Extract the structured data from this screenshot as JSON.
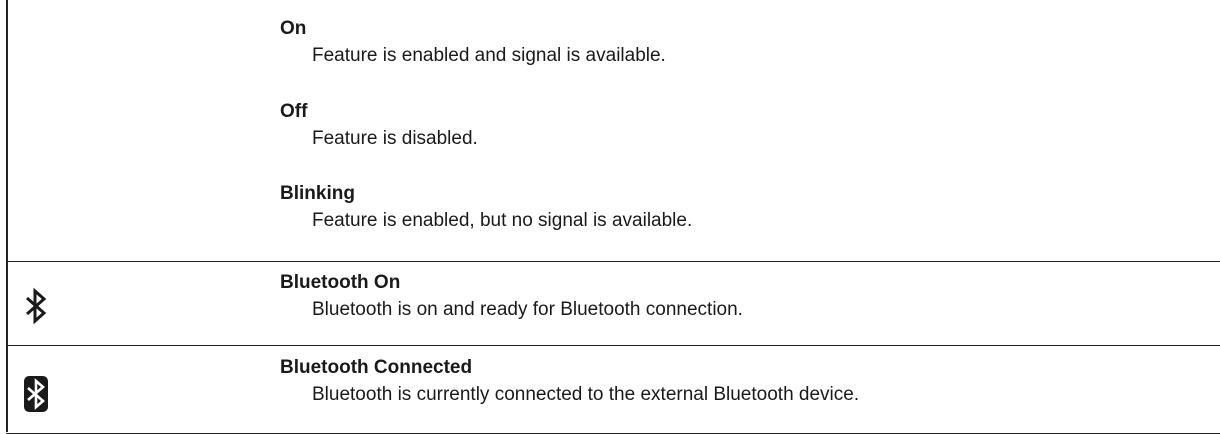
{
  "rows": [
    {
      "entries": [
        {
          "term": "On",
          "description": "Feature is enabled and signal is available."
        },
        {
          "term": "Off",
          "description": "Feature is disabled."
        },
        {
          "term": "Blinking",
          "description": "Feature is enabled, but no signal is available."
        }
      ]
    },
    {
      "icon": "bluetooth-icon",
      "entries": [
        {
          "term": "Bluetooth On",
          "description": "Bluetooth is on and ready for Bluetooth connection."
        }
      ]
    },
    {
      "icon": "bluetooth-connected-icon",
      "entries": [
        {
          "term": "Bluetooth Connected",
          "description": "Bluetooth is currently connected to the external Bluetooth device."
        }
      ]
    }
  ]
}
